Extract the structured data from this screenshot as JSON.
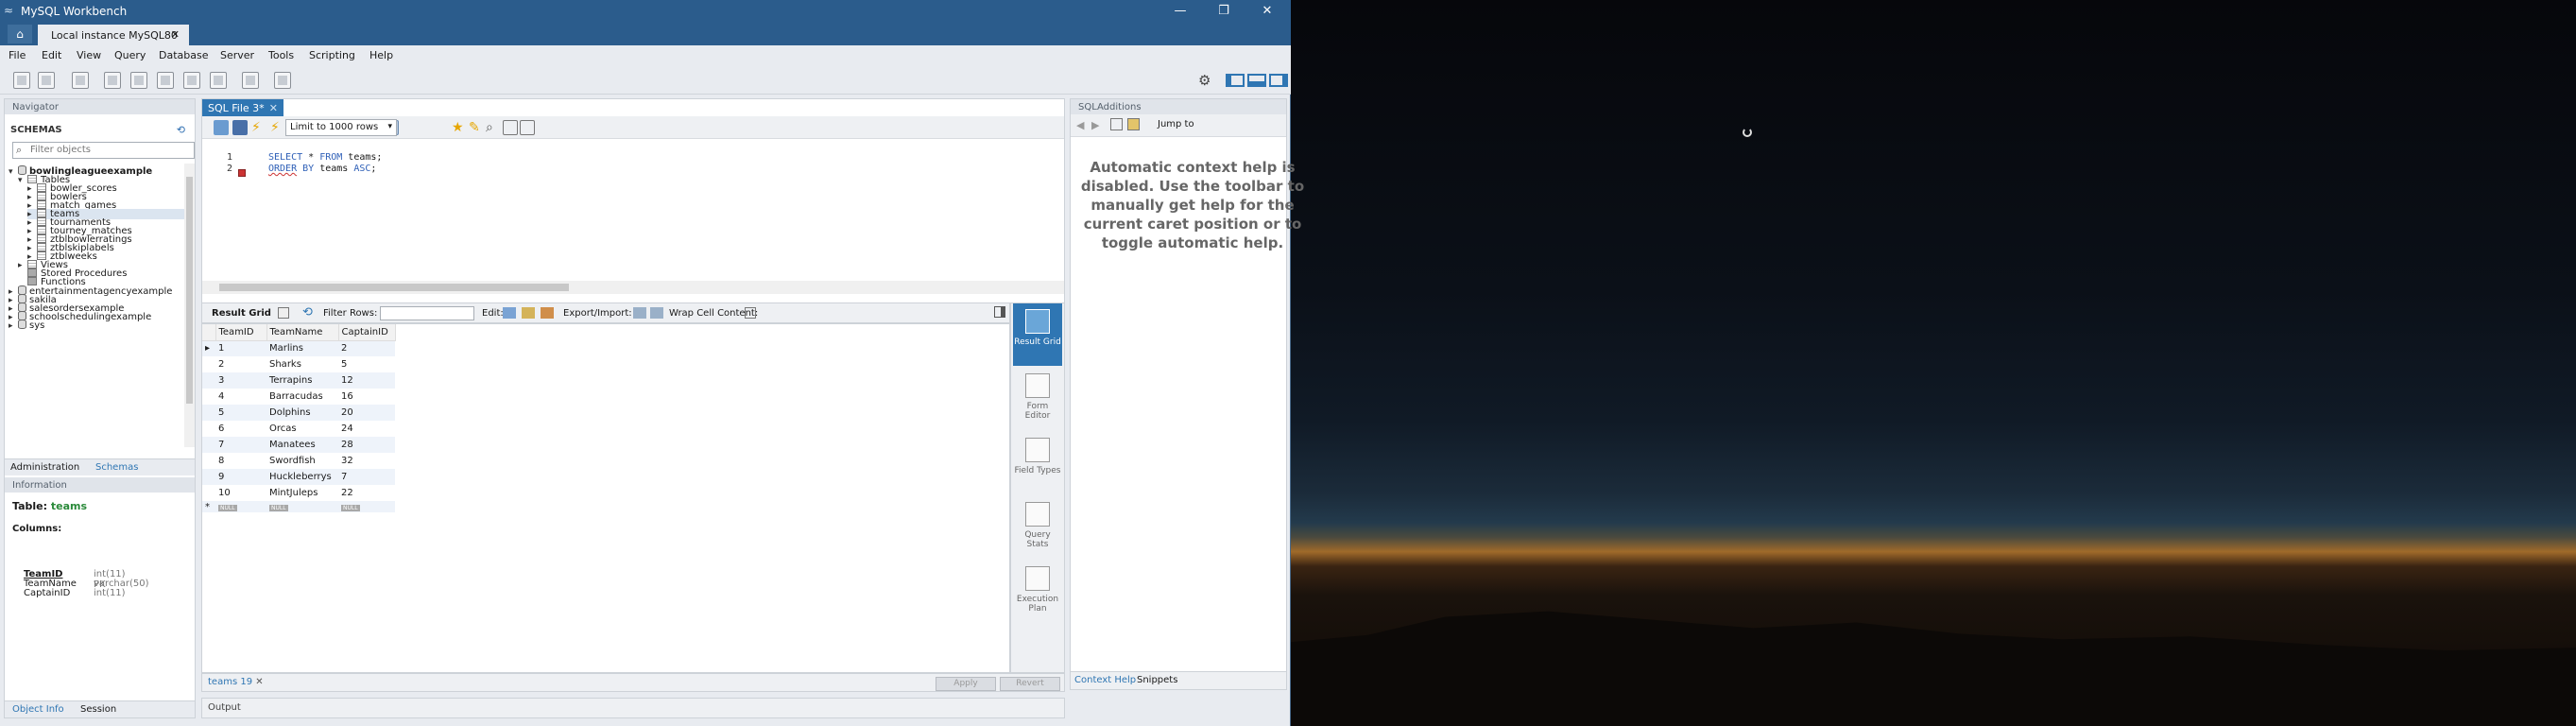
{
  "window": {
    "title": "MySQL Workbench",
    "connection_tab": "Local instance MySQL80"
  },
  "menu": [
    "File",
    "Edit",
    "View",
    "Query",
    "Database",
    "Server",
    "Tools",
    "Scripting",
    "Help"
  ],
  "navigator": {
    "header": "Navigator",
    "schemas_label": "SCHEMAS",
    "filter_placeholder": "Filter objects",
    "active_db": "bowlingleagueexample",
    "tables_label": "Tables",
    "tables": [
      "bowler_scores",
      "bowlers",
      "match_games",
      "teams",
      "tournaments",
      "tourney_matches",
      "ztblbowlerratings",
      "ztblskiplabels",
      "ztblweeks"
    ],
    "views": "Views",
    "procs": "Stored Procedures",
    "funcs": "Functions",
    "other_dbs": [
      "entertainmentagencyexample",
      "sakila",
      "salesordersexample",
      "schoolschedulingexample",
      "sys"
    ],
    "tabs": [
      "Administration",
      "Schemas"
    ],
    "info_header": "Information",
    "info_table_label": "Table:",
    "info_table_name": "teams",
    "columns_label": "Columns:",
    "columns": [
      {
        "name": "TeamID",
        "type": "int(11) PK"
      },
      {
        "name": "TeamName",
        "type": "varchar(50)"
      },
      {
        "name": "CaptainID",
        "type": "int(11)"
      }
    ],
    "bottom_tabs": [
      "Object Info",
      "Session"
    ]
  },
  "editor": {
    "tab": "SQL File 3*",
    "limit": "Limit to 1000 rows",
    "lines": [
      {
        "n": "1",
        "kw1": "SELECT",
        "rest1": " * ",
        "kw2": "FROM",
        "rest2": " teams;"
      },
      {
        "n": "2",
        "kw1": "ORDER",
        "rest1": " ",
        "kw2": "BY",
        "rest2": " teams ",
        "kw3": "ASC",
        "rest3": ";"
      }
    ]
  },
  "result": {
    "label": "Result Grid",
    "filter_label": "Filter Rows:",
    "edit_label": "Edit:",
    "export_label": "Export/Import:",
    "wrap_label": "Wrap Cell Content:",
    "columns": [
      "TeamID",
      "TeamName",
      "CaptainID"
    ],
    "rows": [
      [
        "1",
        "Marlins",
        "2"
      ],
      [
        "2",
        "Sharks",
        "5"
      ],
      [
        "3",
        "Terrapins",
        "12"
      ],
      [
        "4",
        "Barracudas",
        "16"
      ],
      [
        "5",
        "Dolphins",
        "20"
      ],
      [
        "6",
        "Orcas",
        "24"
      ],
      [
        "7",
        "Manatees",
        "28"
      ],
      [
        "8",
        "Swordfish",
        "32"
      ],
      [
        "9",
        "Huckleberrys",
        "7"
      ],
      [
        "10",
        "MintJuleps",
        "22"
      ]
    ],
    "null_text": "NULL",
    "side": [
      "Result Grid",
      "Form Editor",
      "Field Types",
      "Query Stats",
      "Execution Plan"
    ],
    "tab": "teams 19",
    "apply": "Apply",
    "revert": "Revert",
    "output": "Output"
  },
  "sqladditions": {
    "header": "SQLAdditions",
    "jump": "Jump to",
    "help": "Automatic context help is disabled. Use the toolbar to manually get help for the current caret position or to toggle automatic help.",
    "tabs": [
      "Context Help",
      "Snippets"
    ]
  }
}
